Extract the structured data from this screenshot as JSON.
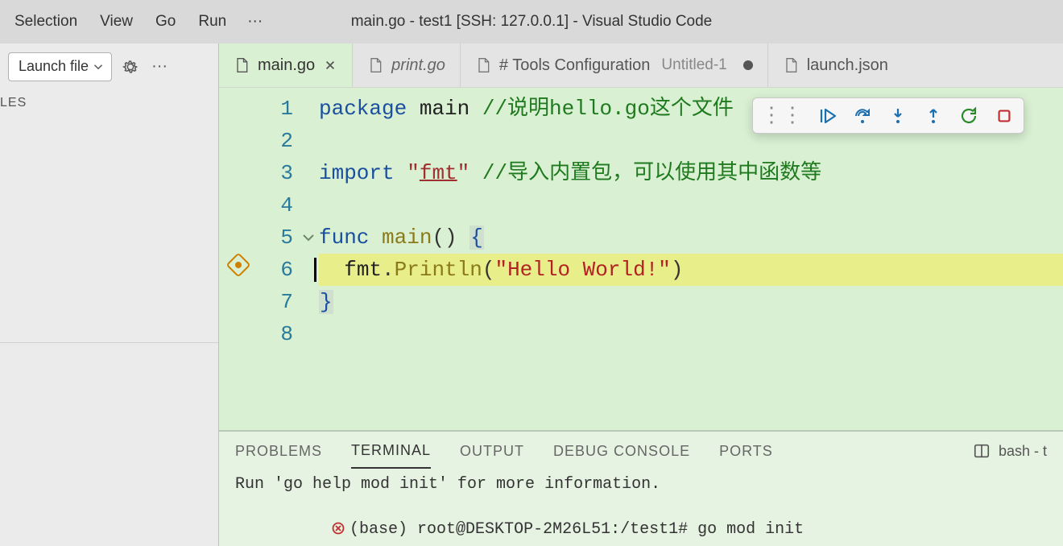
{
  "menu": {
    "items": [
      "Selection",
      "View",
      "Go",
      "Run"
    ],
    "ellipsis": "···"
  },
  "window": {
    "title": "main.go - test1 [SSH: 127.0.0.1] - Visual Studio Code"
  },
  "sidebar": {
    "launch_label": "Launch file",
    "section_label": "LES"
  },
  "tabs": [
    {
      "label": "main.go",
      "active": true,
      "italic": false,
      "closeable": true,
      "dirty": false
    },
    {
      "label": "print.go",
      "active": false,
      "italic": true,
      "closeable": false,
      "dirty": false
    },
    {
      "label": "# Tools Configuration",
      "suffix": "Untitled-1",
      "active": false,
      "italic": false,
      "closeable": false,
      "dirty": true
    },
    {
      "label": "launch.json",
      "active": false,
      "italic": false,
      "closeable": false,
      "dirty": false
    }
  ],
  "editor": {
    "line_numbers": [
      "1",
      "2",
      "3",
      "4",
      "5",
      "6",
      "7",
      "8"
    ],
    "breakpoint_line": 6,
    "fold_line": 5,
    "highlighted_line": 6,
    "lines": {
      "l1_kw": "package",
      "l1_id": " main ",
      "l1_cm": "//说明hello.go这个文件",
      "l3_kw": "import",
      "l3_sp": " ",
      "l3_q1": "\"",
      "l3_s": "fmt",
      "l3_q2": "\"",
      "l3_sp2": " ",
      "l3_cm": "//导入内置包，可以使用其中函数等",
      "l5_kw": "func",
      "l5_sp": " ",
      "l5_fn": "main",
      "l5_par": "()",
      "l5_sp2": " ",
      "l5_br": "{",
      "l6_indent": "  ",
      "l6_obj": "fmt",
      "l6_dot": ".",
      "l6_call": "Println",
      "l6_paropen": "(",
      "l6_str": "\"Hello World!\"",
      "l6_parclose": ")",
      "l7_br": "}"
    }
  },
  "debug_toolbar": {
    "buttons": [
      "continue",
      "step-over",
      "step-into",
      "step-out",
      "restart",
      "stop"
    ]
  },
  "panel": {
    "tabs": [
      "PROBLEMS",
      "TERMINAL",
      "OUTPUT",
      "DEBUG CONSOLE",
      "PORTS"
    ],
    "active_tab": "TERMINAL",
    "shell_label": "bash - t",
    "terminal": {
      "line1": "Run 'go help mod init' for more information.",
      "line2": "(base) root@DESKTOP-2M26L51:/test1# go mod init"
    }
  }
}
